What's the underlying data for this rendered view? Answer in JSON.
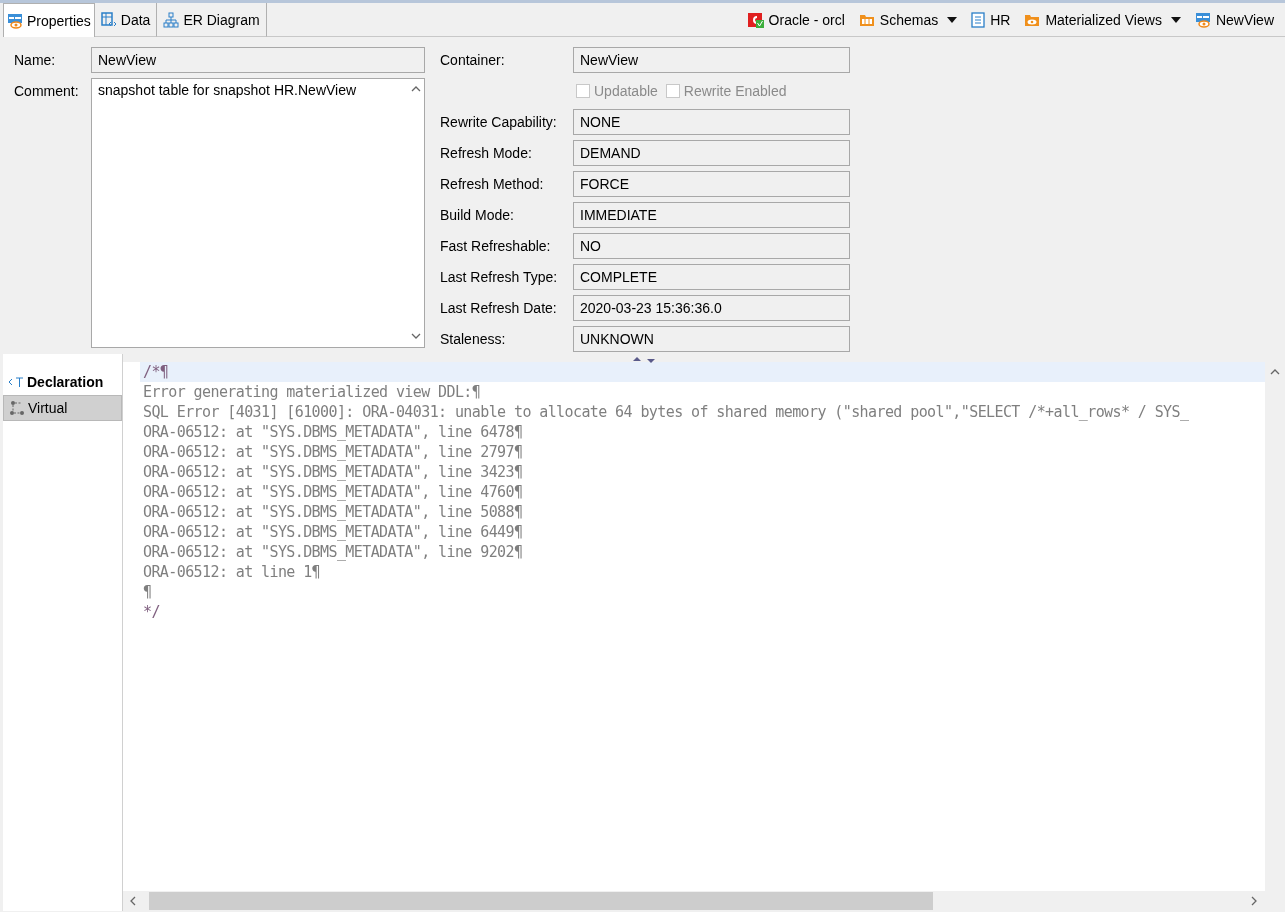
{
  "tabs": [
    {
      "label": "Properties",
      "selected": true
    },
    {
      "label": "Data",
      "selected": false
    },
    {
      "label": "ER Diagram",
      "selected": false
    }
  ],
  "breadcrumb": [
    {
      "label": "Oracle - orcl",
      "kind": "connection",
      "dropdown": false
    },
    {
      "label": "Schemas",
      "kind": "folder",
      "dropdown": true
    },
    {
      "label": "HR",
      "kind": "schema",
      "dropdown": false
    },
    {
      "label": "Materialized Views",
      "kind": "views",
      "dropdown": true
    },
    {
      "label": "NewView",
      "kind": "view",
      "dropdown": false
    }
  ],
  "name": {
    "label": "Name:",
    "value": "NewView"
  },
  "comment": {
    "label": "Comment:",
    "value": "snapshot table for snapshot HR.NewView"
  },
  "container": {
    "label": "Container:",
    "value": "NewView"
  },
  "checkboxes": [
    {
      "label": "Updatable",
      "checked": false,
      "disabled": true
    },
    {
      "label": "Rewrite Enabled",
      "checked": false,
      "disabled": true
    }
  ],
  "fields": [
    {
      "label": "Rewrite Capability:",
      "value": "NONE"
    },
    {
      "label": "Refresh Mode:",
      "value": "DEMAND"
    },
    {
      "label": "Refresh Method:",
      "value": "FORCE"
    },
    {
      "label": "Build Mode:",
      "value": "IMMEDIATE"
    },
    {
      "label": "Fast Refreshable:",
      "value": "NO"
    },
    {
      "label": "Last Refresh Type:",
      "value": "COMPLETE"
    },
    {
      "label": "Last Refresh Date:",
      "value": "2020-03-23 15:36:36.0"
    },
    {
      "label": "Staleness:",
      "value": "UNKNOWN"
    }
  ],
  "side_tabs": [
    {
      "label": "Declaration",
      "kind": "declaration",
      "selected": true
    },
    {
      "label": "Virtual",
      "kind": "virtual",
      "selected": false
    }
  ],
  "code_lines": [
    {
      "text": "/*¶",
      "kind": "comment"
    },
    {
      "text": "Error generating materialized view DDL:¶",
      "kind": "text"
    },
    {
      "text": "SQL Error [4031] [61000]: ORA-04031: unable to allocate 64 bytes of shared memory (\"shared pool\",\"SELECT /*+all_rows* / SYS_",
      "kind": "text"
    },
    {
      "text": "ORA-06512: at \"SYS.DBMS_METADATA\", line 6478¶",
      "kind": "text"
    },
    {
      "text": "ORA-06512: at \"SYS.DBMS_METADATA\", line 2797¶",
      "kind": "text"
    },
    {
      "text": "ORA-06512: at \"SYS.DBMS_METADATA\", line 3423¶",
      "kind": "text"
    },
    {
      "text": "ORA-06512: at \"SYS.DBMS_METADATA\", line 4760¶",
      "kind": "text"
    },
    {
      "text": "ORA-06512: at \"SYS.DBMS_METADATA\", line 5088¶",
      "kind": "text"
    },
    {
      "text": "ORA-06512: at \"SYS.DBMS_METADATA\", line 6449¶",
      "kind": "text"
    },
    {
      "text": "ORA-06512: at \"SYS.DBMS_METADATA\", line 9202¶",
      "kind": "text"
    },
    {
      "text": "ORA-06512: at line 1¶",
      "kind": "text"
    },
    {
      "text": "¶",
      "kind": "text"
    },
    {
      "text": "*/",
      "kind": "comment"
    }
  ]
}
